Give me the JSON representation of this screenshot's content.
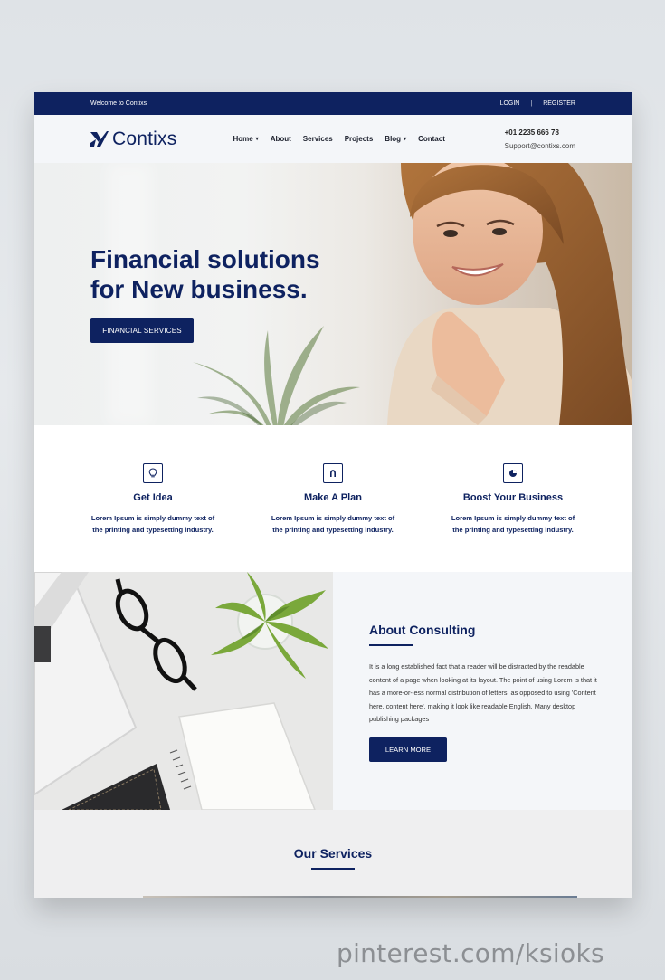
{
  "topbar": {
    "welcome": "Welcome to Contixs",
    "login": "LOGIN",
    "separator": "|",
    "register": "REGISTER"
  },
  "header": {
    "brand": "Contixs",
    "nav": {
      "home": "Home",
      "about": "About",
      "services": "Services",
      "projects": "Projects",
      "blog": "Blog",
      "contact": "Contact"
    },
    "phone": "+01 2235 666 78",
    "email": "Support@contixs.com"
  },
  "hero": {
    "title_line1": "Financial solutions",
    "title_line2": "for New business.",
    "button": "FINANCIAL SERVICES"
  },
  "features": [
    {
      "icon": "lightbulb-icon",
      "title": "Get Idea",
      "text": "Lorem Ipsum is simply dummy text of the printing and typesetting industry."
    },
    {
      "icon": "magnet-icon",
      "title": "Make A Plan",
      "text": "Lorem Ipsum is simply dummy text of the printing and typesetting industry."
    },
    {
      "icon": "pie-chart-icon",
      "title": "Boost Your Business",
      "text": "Lorem Ipsum is simply dummy text of the printing and typesetting industry."
    }
  ],
  "about": {
    "title": "About Consulting",
    "text": "It is a long established fact that a reader will be distracted by the readable content of a page when looking at its layout. The point of using Lorem is that it has a more-or-less normal distribution of letters, as opposed to using 'Content here, content here', making it look like readable English. Many desktop publishing packages",
    "button": "LEARN MORE"
  },
  "services": {
    "title": "Our Services"
  },
  "watermark": "pinterest.com/ksioks",
  "colors": {
    "primary": "#0e2260",
    "background": "#f4f6f9"
  }
}
